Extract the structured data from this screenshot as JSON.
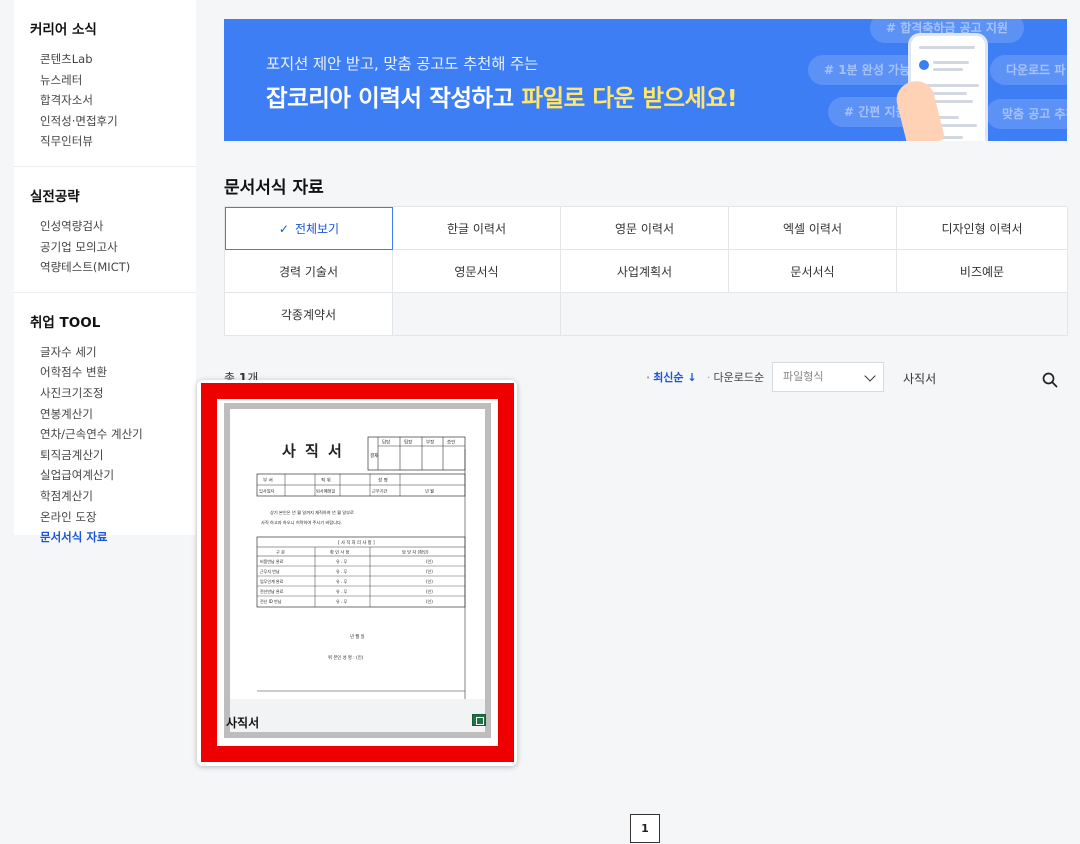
{
  "sidebar": {
    "groups": [
      {
        "title": "커리어 소식",
        "items": [
          "콘텐츠Lab",
          "뉴스레터",
          "합격자소서",
          "인적성·면접후기",
          "직무인터뷰"
        ]
      },
      {
        "title": "실전공략",
        "items": [
          "인성역량검사",
          "공기업 모의고사",
          "역량테스트(MICT)"
        ]
      },
      {
        "title": "취업 TOOL",
        "items": [
          "글자수 세기",
          "어학점수 변환",
          "사진크기조정",
          "연봉계산기",
          "연차/근속연수 계산기",
          "퇴직금계산기",
          "실업급여계산기",
          "학점계산기",
          "온라인 도장",
          "문서서식 자료"
        ]
      }
    ],
    "active_item": "문서서식 자료"
  },
  "banner": {
    "subtitle": "포지션 제안 받고, 맞춤 공고도 추천해 주는",
    "title_prefix": "잡코리아 이력서 작성하고 ",
    "title_highlight": "파일로 다운 받으세요!",
    "tags": [
      "# 합격축하금 공고 지원",
      "# 1분 완성 가능",
      "다운로드 파",
      "# 간편 지원",
      "맞춤 공고 추천"
    ]
  },
  "section_title": "문서서식 자료",
  "categories": [
    "전체보기",
    "한글 이력서",
    "영문 이력서",
    "엑셀 이력서",
    "디자인형 이력서",
    "경력 기술서",
    "영문서식",
    "사업계획서",
    "문서서식",
    "비즈예문",
    "각종계약서"
  ],
  "active_category": "전체보기",
  "toolbar": {
    "count_label": "총 ",
    "count_value": "1",
    "count_suffix": "개",
    "sort_latest": "최신순",
    "sort_download": "다운로드순",
    "file_type_placeholder": "파일형식",
    "search_value": "사직서"
  },
  "results": [
    {
      "title": "사직서",
      "file_type": "xls",
      "preview": {
        "heading": "사 직 서",
        "approval_side": "결재",
        "approval_cols": [
          "담당",
          "팀장",
          "부장",
          "승인"
        ],
        "info_row1": [
          "부 서",
          "",
          "직 위",
          "",
          "성 명",
          ""
        ],
        "info_row2": [
          "입사일자",
          "",
          "퇴사예정일",
          "",
          "근무기간",
          "년  월"
        ],
        "body_line1": "상기 본인은 년  월  일까지 재직하여    년   월   일부로",
        "body_line2": "사직 하고자 하오니 허락하여 주시기 바랍니다.",
        "table_title": "[ 사 직 처 리 사 항 ]",
        "table_headers": [
          "구  분",
          "확 인 사 항",
          "담 당 자 (확인)"
        ],
        "table_rows": [
          [
            "비품반납 완료",
            "유 . 무",
            "(인)"
          ],
          [
            "근무지 반납",
            "유 . 무",
            "(인)"
          ],
          [
            "업무인계 완료",
            "유 . 무",
            "(인)"
          ],
          [
            "전산반납 완료",
            "유 . 무",
            "(인)"
          ],
          [
            "전산 ID 반납",
            "유 . 무",
            "(인)"
          ]
        ],
        "date_line": "년    월    일",
        "sign_line": "위 본인       성 명 :          (인)"
      }
    }
  ],
  "pagination": {
    "pages": [
      "1"
    ],
    "current": "1"
  }
}
